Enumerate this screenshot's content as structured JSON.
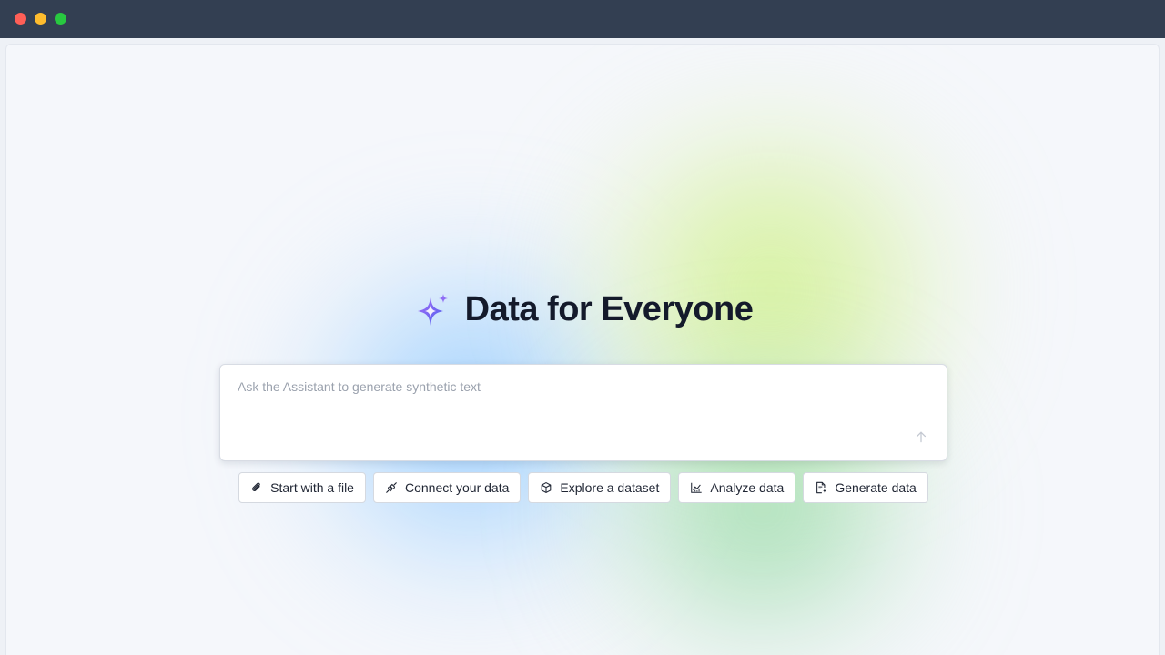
{
  "window": {
    "controls": [
      "close",
      "minimize",
      "maximize"
    ]
  },
  "hero": {
    "title": "Data for Everyone",
    "logo_icon": "sparkle-icon"
  },
  "prompt": {
    "placeholder": "Ask the Assistant to generate synthetic text",
    "value": "",
    "send_icon": "arrow-up-icon"
  },
  "actions": [
    {
      "label": "Start with a file",
      "icon": "paperclip-icon"
    },
    {
      "label": "Connect your data",
      "icon": "plug-icon"
    },
    {
      "label": "Explore a dataset",
      "icon": "cube-icon"
    },
    {
      "label": "Analyze data",
      "icon": "chart-icon"
    },
    {
      "label": "Generate data",
      "icon": "document-sparkle-icon"
    }
  ],
  "colors": {
    "titlebar": "#333f52",
    "close": "#ff5f57",
    "minimize": "#febc2e",
    "maximize": "#28c840",
    "title_text": "#141a2b",
    "logo_gradient_start": "#8a5cf6",
    "logo_gradient_end": "#5b6cf0"
  }
}
